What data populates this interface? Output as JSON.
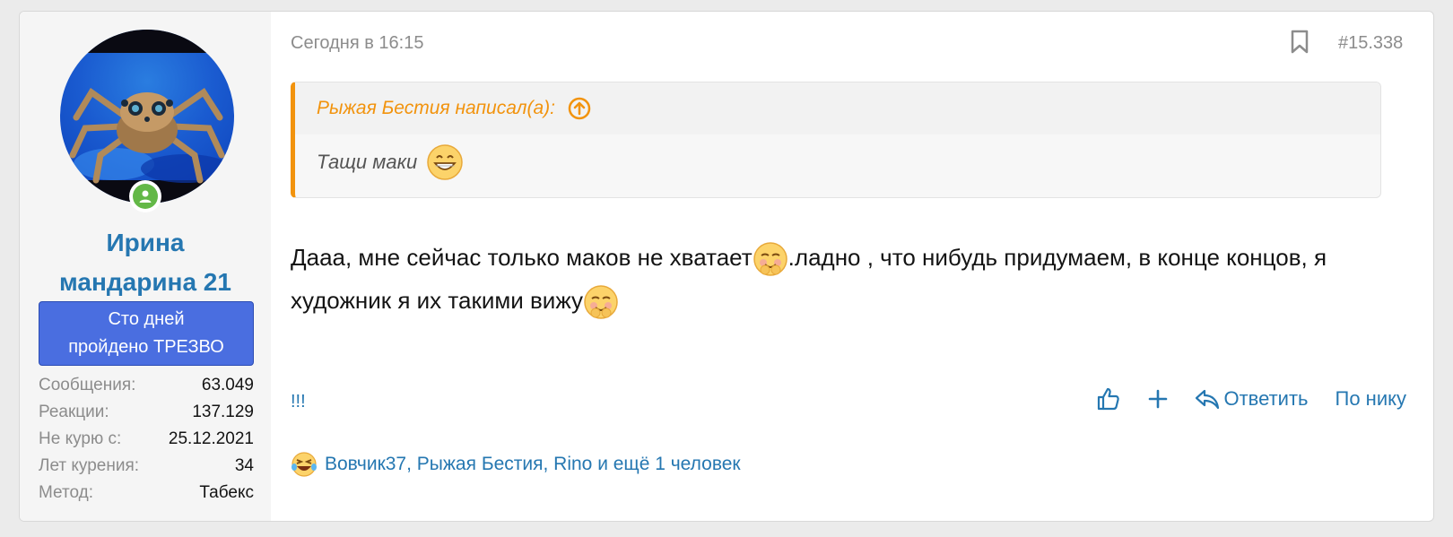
{
  "user": {
    "name_line1": "Ирина",
    "name_line2": "мандарина 21",
    "title_line1": "Сто дней",
    "title_line2": "пройдено ТРЕЗВО",
    "stats": [
      {
        "label": "Сообщения:",
        "value": "63.049"
      },
      {
        "label": "Реакции:",
        "value": "137.129"
      },
      {
        "label": "Не курю с:",
        "value": "25.12.2021"
      },
      {
        "label": "Лет курения:",
        "value": "34"
      },
      {
        "label": "Метод:",
        "value": "Табекс"
      }
    ]
  },
  "post": {
    "date": "Сегодня в 16:15",
    "number": "#15.338",
    "quote": {
      "author": "Рыжая Бестия написал(а):",
      "text": "Тащи маки"
    },
    "message": {
      "part1": "Дааа, мне сейчас только маков не хватает",
      "part2": ".ладно , что нибудь придумаем, в конце концов, я художник я их такими вижу"
    },
    "report_link": "!!!",
    "actions": {
      "reply": "Ответить",
      "by_nick": "По нику"
    },
    "reactions_text": "Вовчик37, Рыжая Бестия, Rino и ещё 1 человек"
  },
  "colors": {
    "link": "#2577b1",
    "quote_accent": "#f2930d",
    "badge_bg": "#4a6ee0",
    "online": "#63b847"
  },
  "icons": [
    "bookmark-icon",
    "arrow-up-circle-icon",
    "grin-emoji-icon",
    "blush-emoji-icon",
    "thumbs-up-icon",
    "plus-icon",
    "reply-arrow-icon",
    "laughing-reaction-icon",
    "online-user-icon"
  ]
}
